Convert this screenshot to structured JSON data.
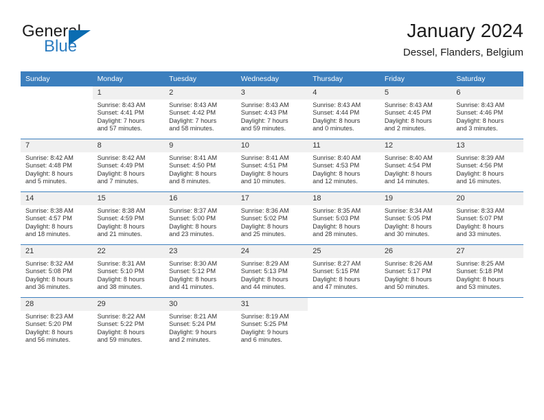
{
  "brand": {
    "name_top": "General",
    "name_bottom": "Blue",
    "accent_color": "#2b7cc0",
    "triangle_color": "#0b6cb1"
  },
  "header": {
    "title": "January 2024",
    "subtitle": "Dessel, Flanders, Belgium"
  },
  "theme": {
    "header_bg": "#3c7fbe",
    "header_text": "#ffffff",
    "daynum_bg": "#f0f0f0",
    "body_text": "#333333"
  },
  "calendar": {
    "weekday_headers": [
      "Sunday",
      "Monday",
      "Tuesday",
      "Wednesday",
      "Thursday",
      "Friday",
      "Saturday"
    ],
    "weeks": [
      [
        {
          "day": "",
          "lines": []
        },
        {
          "day": "1",
          "lines": [
            "Sunrise: 8:43 AM",
            "Sunset: 4:41 PM",
            "Daylight: 7 hours",
            "and 57 minutes."
          ]
        },
        {
          "day": "2",
          "lines": [
            "Sunrise: 8:43 AM",
            "Sunset: 4:42 PM",
            "Daylight: 7 hours",
            "and 58 minutes."
          ]
        },
        {
          "day": "3",
          "lines": [
            "Sunrise: 8:43 AM",
            "Sunset: 4:43 PM",
            "Daylight: 7 hours",
            "and 59 minutes."
          ]
        },
        {
          "day": "4",
          "lines": [
            "Sunrise: 8:43 AM",
            "Sunset: 4:44 PM",
            "Daylight: 8 hours",
            "and 0 minutes."
          ]
        },
        {
          "day": "5",
          "lines": [
            "Sunrise: 8:43 AM",
            "Sunset: 4:45 PM",
            "Daylight: 8 hours",
            "and 2 minutes."
          ]
        },
        {
          "day": "6",
          "lines": [
            "Sunrise: 8:43 AM",
            "Sunset: 4:46 PM",
            "Daylight: 8 hours",
            "and 3 minutes."
          ]
        }
      ],
      [
        {
          "day": "7",
          "lines": [
            "Sunrise: 8:42 AM",
            "Sunset: 4:48 PM",
            "Daylight: 8 hours",
            "and 5 minutes."
          ]
        },
        {
          "day": "8",
          "lines": [
            "Sunrise: 8:42 AM",
            "Sunset: 4:49 PM",
            "Daylight: 8 hours",
            "and 7 minutes."
          ]
        },
        {
          "day": "9",
          "lines": [
            "Sunrise: 8:41 AM",
            "Sunset: 4:50 PM",
            "Daylight: 8 hours",
            "and 8 minutes."
          ]
        },
        {
          "day": "10",
          "lines": [
            "Sunrise: 8:41 AM",
            "Sunset: 4:51 PM",
            "Daylight: 8 hours",
            "and 10 minutes."
          ]
        },
        {
          "day": "11",
          "lines": [
            "Sunrise: 8:40 AM",
            "Sunset: 4:53 PM",
            "Daylight: 8 hours",
            "and 12 minutes."
          ]
        },
        {
          "day": "12",
          "lines": [
            "Sunrise: 8:40 AM",
            "Sunset: 4:54 PM",
            "Daylight: 8 hours",
            "and 14 minutes."
          ]
        },
        {
          "day": "13",
          "lines": [
            "Sunrise: 8:39 AM",
            "Sunset: 4:56 PM",
            "Daylight: 8 hours",
            "and 16 minutes."
          ]
        }
      ],
      [
        {
          "day": "14",
          "lines": [
            "Sunrise: 8:38 AM",
            "Sunset: 4:57 PM",
            "Daylight: 8 hours",
            "and 18 minutes."
          ]
        },
        {
          "day": "15",
          "lines": [
            "Sunrise: 8:38 AM",
            "Sunset: 4:59 PM",
            "Daylight: 8 hours",
            "and 21 minutes."
          ]
        },
        {
          "day": "16",
          "lines": [
            "Sunrise: 8:37 AM",
            "Sunset: 5:00 PM",
            "Daylight: 8 hours",
            "and 23 minutes."
          ]
        },
        {
          "day": "17",
          "lines": [
            "Sunrise: 8:36 AM",
            "Sunset: 5:02 PM",
            "Daylight: 8 hours",
            "and 25 minutes."
          ]
        },
        {
          "day": "18",
          "lines": [
            "Sunrise: 8:35 AM",
            "Sunset: 5:03 PM",
            "Daylight: 8 hours",
            "and 28 minutes."
          ]
        },
        {
          "day": "19",
          "lines": [
            "Sunrise: 8:34 AM",
            "Sunset: 5:05 PM",
            "Daylight: 8 hours",
            "and 30 minutes."
          ]
        },
        {
          "day": "20",
          "lines": [
            "Sunrise: 8:33 AM",
            "Sunset: 5:07 PM",
            "Daylight: 8 hours",
            "and 33 minutes."
          ]
        }
      ],
      [
        {
          "day": "21",
          "lines": [
            "Sunrise: 8:32 AM",
            "Sunset: 5:08 PM",
            "Daylight: 8 hours",
            "and 36 minutes."
          ]
        },
        {
          "day": "22",
          "lines": [
            "Sunrise: 8:31 AM",
            "Sunset: 5:10 PM",
            "Daylight: 8 hours",
            "and 38 minutes."
          ]
        },
        {
          "day": "23",
          "lines": [
            "Sunrise: 8:30 AM",
            "Sunset: 5:12 PM",
            "Daylight: 8 hours",
            "and 41 minutes."
          ]
        },
        {
          "day": "24",
          "lines": [
            "Sunrise: 8:29 AM",
            "Sunset: 5:13 PM",
            "Daylight: 8 hours",
            "and 44 minutes."
          ]
        },
        {
          "day": "25",
          "lines": [
            "Sunrise: 8:27 AM",
            "Sunset: 5:15 PM",
            "Daylight: 8 hours",
            "and 47 minutes."
          ]
        },
        {
          "day": "26",
          "lines": [
            "Sunrise: 8:26 AM",
            "Sunset: 5:17 PM",
            "Daylight: 8 hours",
            "and 50 minutes."
          ]
        },
        {
          "day": "27",
          "lines": [
            "Sunrise: 8:25 AM",
            "Sunset: 5:18 PM",
            "Daylight: 8 hours",
            "and 53 minutes."
          ]
        }
      ],
      [
        {
          "day": "28",
          "lines": [
            "Sunrise: 8:23 AM",
            "Sunset: 5:20 PM",
            "Daylight: 8 hours",
            "and 56 minutes."
          ]
        },
        {
          "day": "29",
          "lines": [
            "Sunrise: 8:22 AM",
            "Sunset: 5:22 PM",
            "Daylight: 8 hours",
            "and 59 minutes."
          ]
        },
        {
          "day": "30",
          "lines": [
            "Sunrise: 8:21 AM",
            "Sunset: 5:24 PM",
            "Daylight: 9 hours",
            "and 2 minutes."
          ]
        },
        {
          "day": "31",
          "lines": [
            "Sunrise: 8:19 AM",
            "Sunset: 5:25 PM",
            "Daylight: 9 hours",
            "and 6 minutes."
          ]
        },
        {
          "day": "",
          "lines": []
        },
        {
          "day": "",
          "lines": []
        },
        {
          "day": "",
          "lines": []
        }
      ]
    ]
  }
}
